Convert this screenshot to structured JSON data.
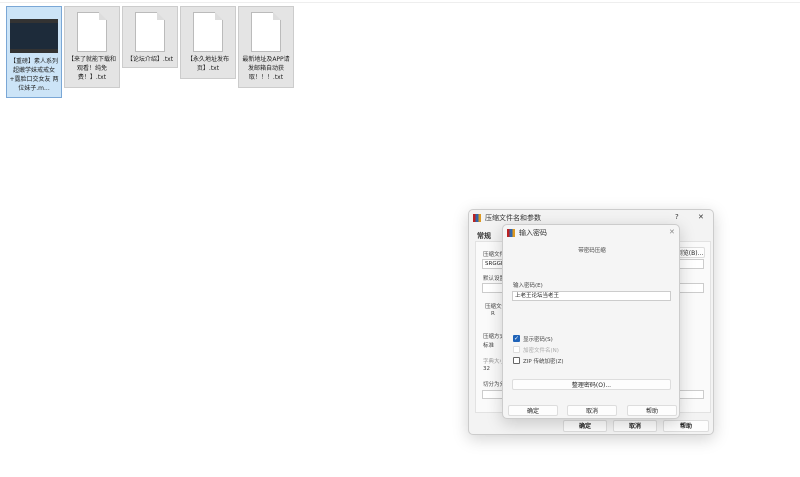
{
  "files": [
    {
      "name": "【重磅】素人系列 超嫩学妹戒戒女+露脸口交女友 两位妹子.m...",
      "type": "video"
    },
    {
      "name": "【来了就能下载和观看！纯免费！】.txt",
      "type": "txt"
    },
    {
      "name": "【论坛介绍】.txt",
      "type": "txt"
    },
    {
      "name": "【永久地址发布页】.txt",
      "type": "txt"
    },
    {
      "name": "最新地址及APP请发邮箱自动获取！！！.txt",
      "type": "txt"
    }
  ],
  "main_dialog": {
    "title": "压缩文件名和参数",
    "help": "?",
    "close": "✕",
    "tab": "常规",
    "archive_name_label": "压缩文件名",
    "archive_name_value": "SRGGN",
    "browse": "浏览(B)...",
    "default_label": "默认设置",
    "format_label": "压缩文件格式",
    "radio_label": "R",
    "method_label": "压缩方式",
    "method_value": "标准",
    "dict_label": "字典大小",
    "dict_value": "32",
    "split_label": "切分为分卷",
    "ok": "确定",
    "cancel": "取消",
    "help_btn": "帮助"
  },
  "pwd_dialog": {
    "title": "输入密码",
    "close": "✕",
    "heading": "带密码压缩",
    "enter_label": "输入密码(E)",
    "password": "上老王论坛当老王",
    "show_password": "显示密码(S)",
    "encrypt_names": "加密文件名(N)",
    "zip_legacy": "ZIP 传统加密(Z)",
    "organize": "整理密码(O)...",
    "ok": "确定",
    "cancel": "取消",
    "help": "帮助",
    "check": "✓"
  }
}
